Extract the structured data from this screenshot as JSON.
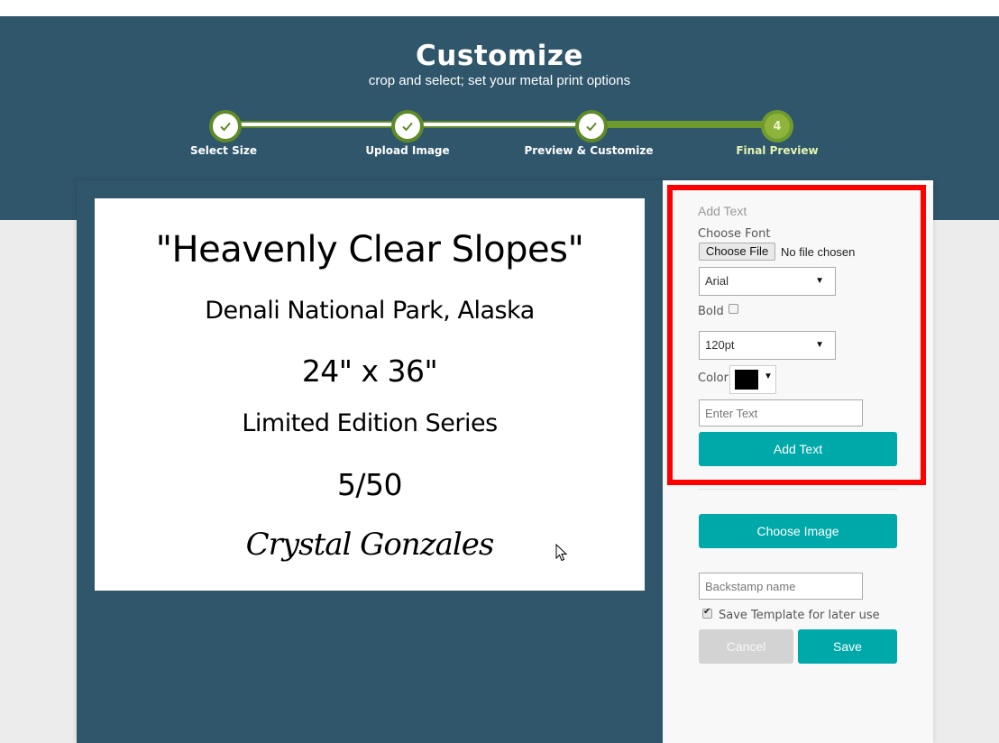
{
  "header": {
    "title": "Customize",
    "subtitle": "crop and select; set your metal print options"
  },
  "stepper": {
    "steps": [
      {
        "label": "Select Size",
        "status": "complete",
        "icon": "check-icon"
      },
      {
        "label": "Upload Image",
        "status": "complete",
        "icon": "check-icon"
      },
      {
        "label": "Preview & Customize",
        "status": "complete",
        "icon": "check-icon"
      },
      {
        "label": "Final Preview",
        "status": "current",
        "number": "4"
      }
    ]
  },
  "preview": {
    "lines": [
      "\"Heavenly Clear Slopes\"",
      "Denali National Park, Alaska",
      "24\" x 36\"",
      "Limited Edition Series",
      "5/50",
      "Crystal Gonzales"
    ]
  },
  "add_text_panel": {
    "heading": "Add Text",
    "choose_font_label": "Choose Font",
    "file_button_label": "Choose File",
    "file_status": "No file chosen",
    "font_select_value": "Arial",
    "bold_label": "Bold",
    "bold_checked": false,
    "size_select_value": "120pt",
    "color_label": "Color",
    "color_value": "#000000",
    "text_input_placeholder": "Enter Text",
    "add_text_button": "Add Text"
  },
  "actions": {
    "choose_image_button": "Choose Image",
    "backstamp_placeholder": "Backstamp name",
    "save_template_label": "Save Template for later use",
    "save_template_checked": true,
    "cancel_button": "Cancel",
    "save_button": "Save"
  },
  "colors": {
    "header_bg": "#30566c",
    "accent_teal": "#00a9a9",
    "step_green": "#5f8a27",
    "step_current": "#8db33a",
    "highlight_red": "#ff0000"
  }
}
